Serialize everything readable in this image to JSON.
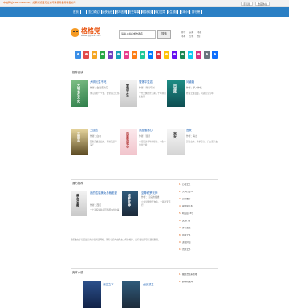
{
  "topbar": {
    "notice": "本站网址www.hxsw.net，如果浏览器无法访问请使用备用域名访问",
    "btn1": "手机版",
    "btn2": "收藏本站"
  },
  "nav": [
    "首页",
    "玄幻奇幻",
    "武侠仙侠",
    "都市言情",
    "历史军事",
    "网游竞技",
    "科幻灵异",
    "女生频道",
    "完本小说",
    "排行榜"
  ],
  "logo": {
    "name": "格格党",
    "url": "www.ggdxs.com"
  },
  "search": {
    "value": "请输入书名或作者名",
    "button": "搜索"
  },
  "quick_links": [
    "排行",
    "完本",
    "书架",
    "书单",
    "分类",
    "热门"
  ],
  "icon_colors": [
    "#3a8ee6",
    "#e24a4a",
    "#f5a623",
    "#28a745",
    "#6f42c1",
    "#17a2b8",
    "#e83e8c",
    "#fd7e14",
    "#20c997",
    "#007bff",
    "#dc3545",
    "#ffc107",
    "#6610f2",
    "#198754",
    "#0dcaf0",
    "#d63384",
    "#6c757d",
    "#0d6efd"
  ],
  "sections": {
    "hot": "推荐阅读",
    "latest": "强力推荐",
    "new": "完本小说"
  },
  "books": [
    {
      "title": "大明长生不死",
      "author": "作者：会说话的刀",
      "desc": "朱元璋的一个梦，梦里自己长生不死",
      "cover_text": "大明长生不死",
      "cover": "c-green"
    },
    {
      "title": "雪落平生遗",
      "author": "作者：刺客与剑",
      "desc": "一代大侠隐世江湖，十年寒剑终出鞘",
      "cover_text": "雪落平生",
      "cover": "c-ink"
    },
    {
      "title": "问道路",
      "author": "作者：梦入神机",
      "desc": "修真之路漫漫，问道红尘百年",
      "cover_text": "问道路",
      "cover": "c-teal"
    },
    {
      "title": "三国志",
      "author": "作者：白衣",
      "desc": "乱世英雄起四方，有枪就是草头王",
      "cover_text": "三国志",
      "cover": "c-gold"
    },
    {
      "title": "凤凰落我心",
      "author": "作者：锦瑟",
      "desc": "一段错过千年的缘分，一生一世的守候",
      "cover_text": "凤凰落我心",
      "cover": "c-pink"
    },
    {
      "title": "宫女",
      "author": "作者：青丝",
      "desc": "深宫之中，步步惊心，只为活下去",
      "cover_text": "宫女",
      "cover": "c-grey"
    }
  ],
  "featured": [
    {
      "title": "我的性感美女总裁老婆",
      "author": "作者：西门",
      "desc": "一个退役特种兵回到都市的故事",
      "cover_text": "美女总裁",
      "cover": "c-blue"
    },
    {
      "title": "至尊修罗武神",
      "author": "作者：善良的蜜蜂",
      "desc": "少年觉醒修罗血脉，一路逆天而行",
      "cover_text": "修罗武神",
      "cover": "c-dark"
    }
  ],
  "desc_long": "我们致力于打造最好的小说阅读网站，所有小说均由网友上传并维护，如有侵权请联系我们删除。",
  "ranking": [
    "万相之王",
    "大奉打更人",
    "深空彼岸",
    "夜的命名术",
    "明克街13号",
    "灵境行者",
    "赤心巡天",
    "宿命之环",
    "道诡异仙",
    "光阴之外",
    "星门"
  ],
  "ranking2": [
    "我的治愈系游戏",
    "超神机械师"
  ],
  "bottom_books": [
    {
      "title": "深空之下",
      "cover": "c-deep"
    },
    {
      "title": "全民领主",
      "cover": "c-dark"
    }
  ]
}
